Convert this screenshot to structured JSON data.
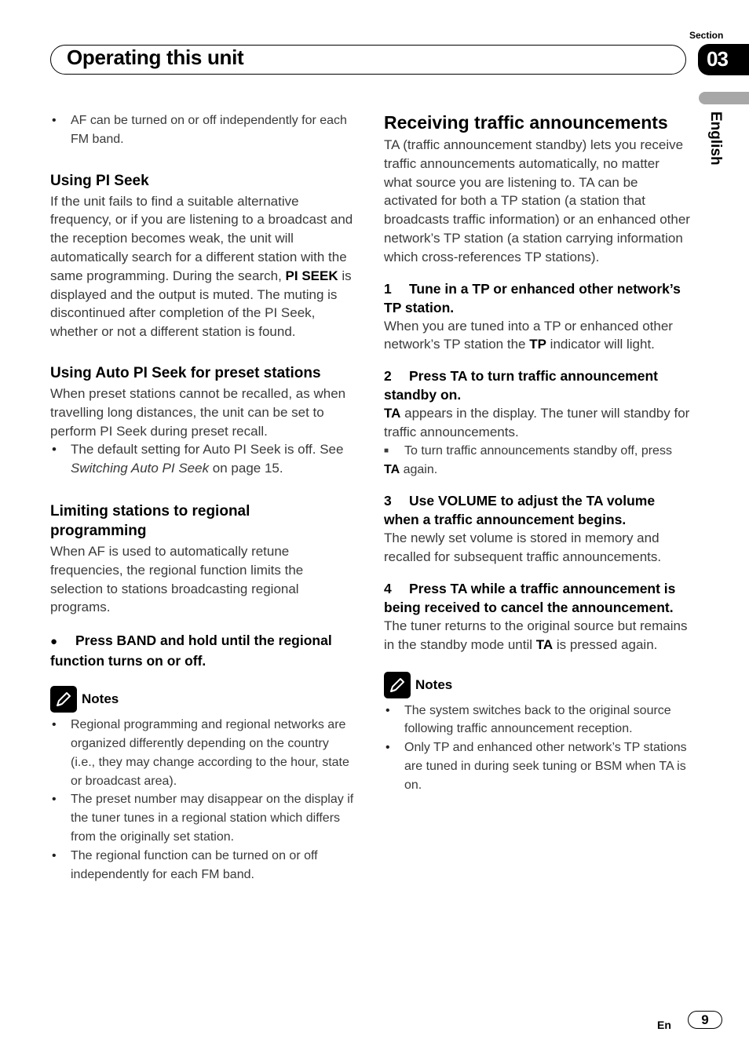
{
  "header": {
    "section_label": "Section",
    "section_number": "03",
    "title": "Operating this unit",
    "language_tab": "English"
  },
  "left": {
    "intro_bullet": "AF can be turned on or off independently for each FM band.",
    "pi_seek": {
      "heading": "Using PI Seek",
      "body_before": "If the unit fails to find a suitable alternative frequency, or if you are listening to a broadcast and the reception becomes weak, the unit will automatically search for a different station with the same programming. During the search, ",
      "body_bold": "PI SEEK",
      "body_after": " is displayed and the output is muted. The muting is discontinued after completion of the PI Seek, whether or not a different station is found."
    },
    "auto_pi_seek": {
      "heading": "Using Auto PI Seek for preset stations",
      "body": "When preset stations cannot be recalled, as when travelling long distances, the unit can be set to perform PI Seek during preset recall.",
      "bullet_before": "The default setting for Auto PI Seek is off. See ",
      "bullet_italic": "Switching Auto PI Seek",
      "bullet_after": " on page 15."
    },
    "regional": {
      "heading": "Limiting stations to regional programming",
      "body": "When AF is used to automatically retune frequencies, the regional function limits the selection to stations broadcasting regional programs.",
      "step": "Press BAND and hold until the regional function turns on or off."
    },
    "notes": {
      "label": "Notes",
      "items": [
        "Regional programming and regional networks are organized differently depending on the country (i.e., they may change according to the hour, state or broadcast area).",
        "The preset number may disappear on the display if the tuner tunes in a regional station which differs from the originally set station.",
        "The regional function can be turned on or off independently for each FM band."
      ]
    }
  },
  "right": {
    "heading": "Receiving traffic announcements",
    "intro": "TA (traffic announcement standby) lets you receive traffic announcements automatically, no matter what source you are listening to. TA can be activated for both a TP station (a station that broadcasts traffic information) or an enhanced other network’s TP station (a station carrying information which cross-references TP stations).",
    "steps": [
      {
        "num": "1",
        "title": "Tune in a TP or enhanced other network’s TP station.",
        "body_before": "When you are tuned into a TP or enhanced other network’s TP station the ",
        "body_bold": "TP",
        "body_after": " indicator will light."
      },
      {
        "num": "2",
        "title": "Press TA to turn traffic announcement standby on.",
        "body_bold": "TA",
        "body_after": " appears in the display. The tuner will standby for traffic announcements.",
        "sub_before": "To turn traffic announcements standby off, press ",
        "sub_bold": "TA",
        "sub_after": " again."
      },
      {
        "num": "3",
        "title": "Use VOLUME to adjust the TA volume when a traffic announcement begins.",
        "body": "The newly set volume is stored in memory and recalled for subsequent traffic announcements."
      },
      {
        "num": "4",
        "title": "Press TA while a traffic announcement is being received to cancel the announcement.",
        "body_before": "The tuner returns to the original source but remains in the standby mode until ",
        "body_bold": "TA",
        "body_after": " is pressed again."
      }
    ],
    "notes": {
      "label": "Notes",
      "items": [
        "The system switches back to the original source following traffic announcement reception.",
        "Only TP and enhanced other network’s TP stations are tuned in during seek tuning or BSM when TA is on."
      ]
    }
  },
  "footer": {
    "lang_code": "En",
    "page_number": "9"
  }
}
